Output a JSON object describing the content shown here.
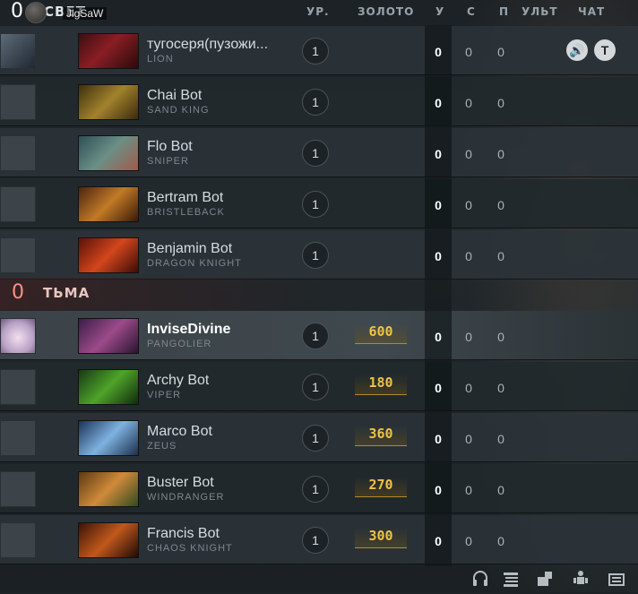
{
  "header": {
    "radiant_score": "0",
    "radiant_name": "СВЕТ",
    "user_name": "JigSaW",
    "col_level": "УР.",
    "col_gold": "ЗОЛОТО",
    "col_kills": "У",
    "col_deaths": "С",
    "col_assists": "П",
    "col_ult": "УЛЬТ",
    "col_chat": "ЧАТ"
  },
  "radiant": [
    {
      "player": "тугосеря(пузожи...",
      "hero": "LION",
      "level": "1",
      "k": "0",
      "d": "0",
      "a": "0"
    },
    {
      "player": "Chai Bot",
      "hero": "SAND KING",
      "level": "1",
      "k": "0",
      "d": "0",
      "a": "0"
    },
    {
      "player": "Flo Bot",
      "hero": "SNIPER",
      "level": "1",
      "k": "0",
      "d": "0",
      "a": "0"
    },
    {
      "player": "Bertram Bot",
      "hero": "BRISTLEBACK",
      "level": "1",
      "k": "0",
      "d": "0",
      "a": "0"
    },
    {
      "player": "Benjamin Bot",
      "hero": "DRAGON KNIGHT",
      "level": "1",
      "k": "0",
      "d": "0",
      "a": "0"
    }
  ],
  "dire_header": {
    "score": "0",
    "name": "ТЬМА"
  },
  "dire": [
    {
      "player": "InviseDivine",
      "hero": "PANGOLIER",
      "level": "1",
      "gold": "600",
      "k": "0",
      "d": "0",
      "a": "0"
    },
    {
      "player": "Archy Bot",
      "hero": "VIPER",
      "level": "1",
      "gold": "180",
      "k": "0",
      "d": "0",
      "a": "0"
    },
    {
      "player": "Marco Bot",
      "hero": "ZEUS",
      "level": "1",
      "gold": "360",
      "k": "0",
      "d": "0",
      "a": "0"
    },
    {
      "player": "Buster Bot",
      "hero": "WINDRANGER",
      "level": "1",
      "gold": "270",
      "k": "0",
      "d": "0",
      "a": "0"
    },
    {
      "player": "Francis Bot",
      "hero": "CHAOS KNIGHT",
      "level": "1",
      "gold": "300",
      "k": "0",
      "d": "0",
      "a": "0"
    }
  ],
  "chat_buttons": {
    "voice": "🔊",
    "text": "T"
  },
  "footer_icons": [
    "headset-icon",
    "list-icon",
    "courier-icon",
    "hero-icon",
    "scoreboard-icon"
  ],
  "colors": {
    "gold": "#f0c245",
    "dire_score": "#ff8f87"
  }
}
